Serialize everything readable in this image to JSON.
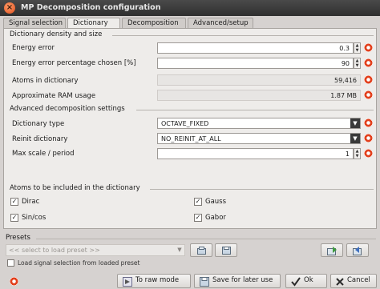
{
  "window": {
    "title": "MP Decomposition configuration"
  },
  "tabs": [
    {
      "label": "Signal selection",
      "active": false
    },
    {
      "label": "Dictionary",
      "active": true
    },
    {
      "label": "Decomposition",
      "active": false
    },
    {
      "label": "Advanced/setup",
      "active": false
    }
  ],
  "density": {
    "section_title": "Dictionary density and size",
    "energy_error_label": "Energy error",
    "energy_error_value": "0.3",
    "energy_pct_label": "Energy error percentage chosen [%]",
    "energy_pct_value": "90",
    "atoms_label": "Atoms in dictionary",
    "atoms_value": "59,416",
    "ram_label": "Approximate RAM usage",
    "ram_value": "1.87 MB"
  },
  "advanced": {
    "section_title": "Advanced decomposition settings",
    "dictionary_type_label": "Dictionary type",
    "dictionary_type_value": "OCTAVE_FIXED",
    "reinit_label": "Reinit dictionary",
    "reinit_value": "NO_REINIT_AT_ALL",
    "max_scale_label": "Max scale / period",
    "max_scale_value": "1"
  },
  "atoms": {
    "section_title": "Atoms to be included in the dictionary",
    "items": [
      {
        "label": "Dirac",
        "checked": true
      },
      {
        "label": "Gauss",
        "checked": true
      },
      {
        "label": "Sin/cos",
        "checked": true
      },
      {
        "label": "Gabor",
        "checked": true
      }
    ]
  },
  "presets": {
    "section_title": "Presets",
    "select_placeholder": "<< select to load preset >>",
    "load_signal_label": "Load signal selection from loaded preset",
    "load_signal_checked": false
  },
  "buttons": {
    "raw_mode": "To raw mode",
    "save_later": "Save for later use",
    "ok": "Ok",
    "cancel": "Cancel"
  },
  "colors": {
    "titlebar": "#3a3a3a",
    "help_icon": "#e2411e",
    "panel": "#eeecea"
  }
}
